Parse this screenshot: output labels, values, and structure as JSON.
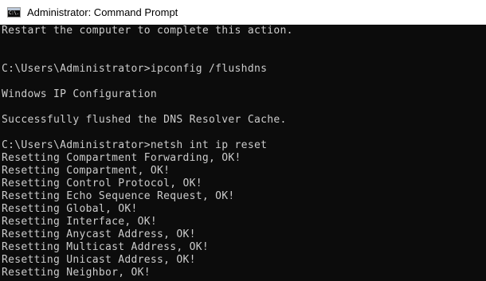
{
  "window": {
    "title": "Administrator: Command Prompt",
    "icon": "cmd-icon",
    "icon_glyph": "C:\\."
  },
  "console": {
    "lines": [
      "Restart the computer to complete this action.",
      "",
      "",
      "C:\\Users\\Administrator>ipconfig /flushdns",
      "",
      "Windows IP Configuration",
      "",
      "Successfully flushed the DNS Resolver Cache.",
      "",
      "C:\\Users\\Administrator>netsh int ip reset",
      "Resetting Compartment Forwarding, OK!",
      "Resetting Compartment, OK!",
      "Resetting Control Protocol, OK!",
      "Resetting Echo Sequence Request, OK!",
      "Resetting Global, OK!",
      "Resetting Interface, OK!",
      "Resetting Anycast Address, OK!",
      "Resetting Multicast Address, OK!",
      "Resetting Unicast Address, OK!",
      "Resetting Neighbor, OK!"
    ]
  },
  "colors": {
    "console_background": "#0c0c0c",
    "console_text": "#cccccc",
    "titlebar_background": "#ffffff"
  }
}
